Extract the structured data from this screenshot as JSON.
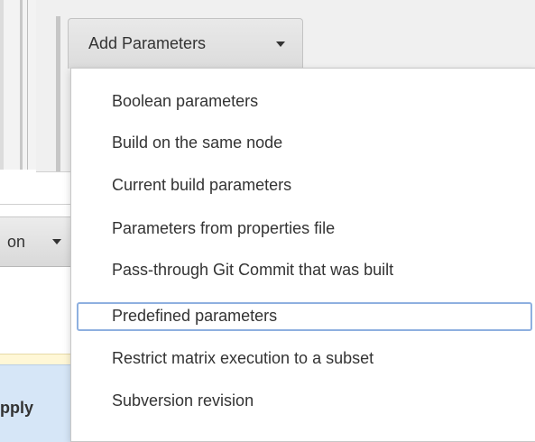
{
  "add_parameters": {
    "label": "Add Parameters",
    "icon": "caret-down-icon"
  },
  "menu": {
    "items": [
      {
        "label": "Boolean parameters"
      },
      {
        "label": "Build on the same node"
      },
      {
        "label": "Current build parameters"
      },
      {
        "label": "Parameters from properties file"
      },
      {
        "label": "Pass-through Git Commit that was built"
      },
      {
        "label": "Predefined parameters",
        "selected": true
      },
      {
        "label": "Restrict matrix execution to a subset"
      },
      {
        "label": "Subversion revision"
      }
    ]
  },
  "partial_dropdown": {
    "label": "on",
    "icon": "caret-down-icon"
  },
  "partial_apply": {
    "label": "pply"
  },
  "colors": {
    "selection_border": "#8eb0e0",
    "apply_bg": "#d6e6f7"
  }
}
